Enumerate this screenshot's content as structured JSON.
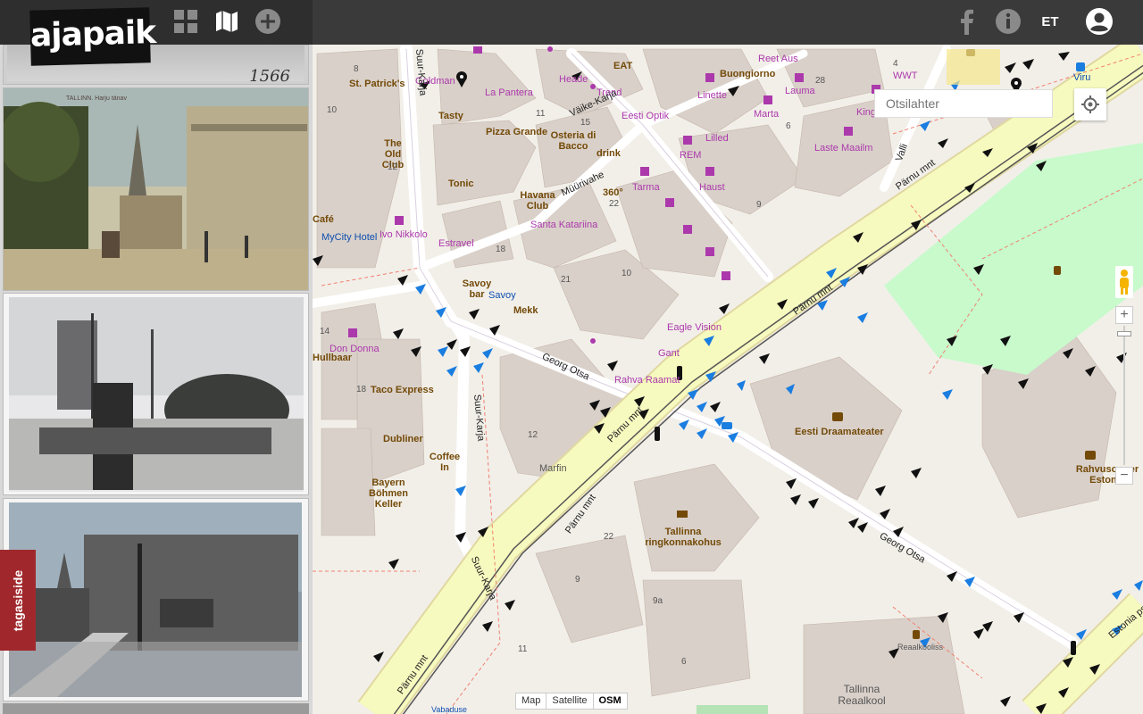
{
  "brand": {
    "logo_text": "ajapaik"
  },
  "toolbar": {
    "grid_icon": "grid-icon",
    "map_icon": "map-icon",
    "add_icon": "plus-circle-icon",
    "facebook_icon": "facebook-icon",
    "info_icon": "info-icon",
    "language": "ET",
    "user_icon": "user-icon"
  },
  "sidebar": {
    "top_strip_number": "1566",
    "photos": [
      {
        "caption": "TALLINN. Harju tänav",
        "kind": "colored postcard"
      },
      {
        "caption": "",
        "kind": "market square photo"
      },
      {
        "caption": "",
        "kind": "street with tram"
      }
    ],
    "feedback_label": "tagasiside"
  },
  "map": {
    "search_placeholder": "Otsilahter",
    "map_types": [
      "Map",
      "Satellite",
      "OSM"
    ],
    "active_map_type": "OSM",
    "zoom_in": "+",
    "zoom_out": "−",
    "colors": {
      "background": "#f2efe9",
      "building": "#d9d0c9",
      "park": "#c8facc",
      "trunk": "#f7fabf",
      "primary_road": "#fff",
      "poi": "#ac39ac",
      "food": "#734a08"
    },
    "labels": [
      {
        "t": "St. Patrick's",
        "k": "b"
      },
      {
        "t": "Goldman",
        "k": "p"
      },
      {
        "t": "La Pantera",
        "k": "p"
      },
      {
        "t": "EAT",
        "k": "b"
      },
      {
        "t": "Heade",
        "k": "p"
      },
      {
        "t": "Trend",
        "k": "p"
      },
      {
        "t": "Reet Aus",
        "k": "p"
      },
      {
        "t": "Buongiorno",
        "k": "b"
      },
      {
        "t": "Lauma",
        "k": "p"
      },
      {
        "t": "Linette",
        "k": "p"
      },
      {
        "t": "WWT",
        "k": "p"
      },
      {
        "t": "Viru",
        "k": "bl"
      },
      {
        "t": "Tasty",
        "k": "b"
      },
      {
        "t": "The Old Club",
        "k": "b"
      },
      {
        "t": "Pizza Grande",
        "k": "b"
      },
      {
        "t": "Osteria di Bacco",
        "k": "b"
      },
      {
        "t": "Eesti Optik",
        "k": "p"
      },
      {
        "t": "Marta",
        "k": "p"
      },
      {
        "t": "King",
        "k": "p"
      },
      {
        "t": "Lilled",
        "k": "p"
      },
      {
        "t": "REM",
        "k": "p"
      },
      {
        "t": "drink",
        "k": "b"
      },
      {
        "t": "Laste Maailm",
        "k": "p"
      },
      {
        "t": "Tonic",
        "k": "b"
      },
      {
        "t": "360°",
        "k": "b"
      },
      {
        "t": "Tarma",
        "k": "p"
      },
      {
        "t": "Haust",
        "k": "p"
      },
      {
        "t": "Havana Club",
        "k": "b"
      },
      {
        "t": "Santa Katariina",
        "k": "p"
      },
      {
        "t": "Café",
        "k": "b"
      },
      {
        "t": "MyCity Hotel",
        "k": "bl"
      },
      {
        "t": "Ivo Nikkolo",
        "k": "p"
      },
      {
        "t": "Estravel",
        "k": "p"
      },
      {
        "t": "Savoy bar",
        "k": "b"
      },
      {
        "t": "Savoy",
        "k": "bl"
      },
      {
        "t": "Mekk",
        "k": "b"
      },
      {
        "t": "Eagle Vision",
        "k": "p"
      },
      {
        "t": "Gant",
        "k": "p"
      },
      {
        "t": "Rahva Raamat",
        "k": "p"
      },
      {
        "t": "Don Donna",
        "k": "p"
      },
      {
        "t": "Hullbaar",
        "k": "b"
      },
      {
        "t": "Taco Express",
        "k": "b"
      },
      {
        "t": "Dubliner",
        "k": "b"
      },
      {
        "t": "Coffee In",
        "k": "b"
      },
      {
        "t": "Bayern Böhmen Keller",
        "k": "b"
      },
      {
        "t": "Marfin",
        "k": "g"
      },
      {
        "t": "Eesti Draamateater",
        "k": "b"
      },
      {
        "t": "Rahvusooper Estonia",
        "k": "b"
      },
      {
        "t": "Tallinna ringkonnakohus",
        "k": "b"
      },
      {
        "t": "Tallinna Reaalkool",
        "k": "g"
      },
      {
        "t": "Reaalkooliss",
        "k": "g"
      },
      {
        "t": "Vabaduse",
        "k": "bl"
      }
    ],
    "streets": [
      "Suur-Karja",
      "Väike-Karja",
      "Müürivahe",
      "Georg Otsa",
      "Pärnu mnt",
      "Valli",
      "Estonia pst"
    ],
    "house_numbers": [
      "8",
      "10",
      "12",
      "15",
      "11",
      "22",
      "9",
      "6",
      "28",
      "18",
      "21",
      "10",
      "14",
      "22",
      "9",
      "9a",
      "6",
      "11",
      "18",
      "12",
      "4"
    ]
  }
}
